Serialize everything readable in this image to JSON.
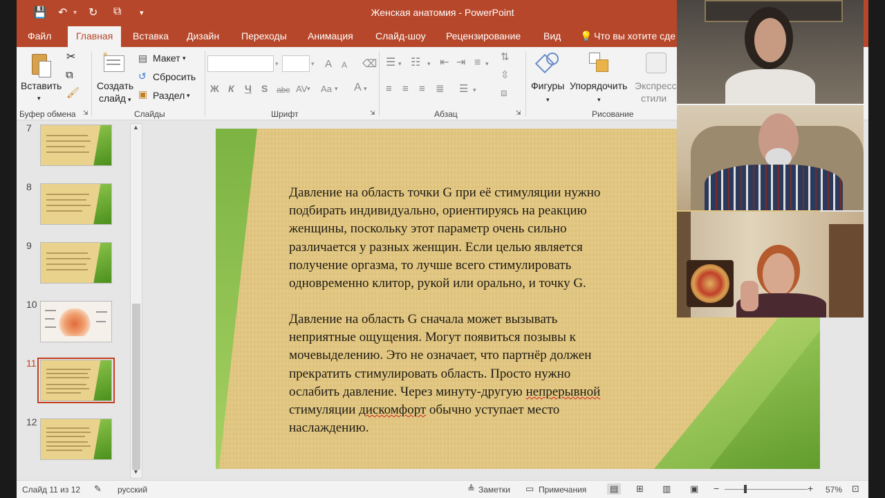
{
  "window": {
    "title": "Женская анатомия - PowerPoint"
  },
  "menu": {
    "tabs": [
      "Файл",
      "Главная",
      "Вставка",
      "Дизайн",
      "Переходы",
      "Анимация",
      "Слайд-шоу",
      "Рецензирование",
      "Вид"
    ],
    "active": "Главная",
    "tell_me": "Что вы хотите сде"
  },
  "ribbon": {
    "clipboard": {
      "paste": "Вставить",
      "label": "Буфер обмена"
    },
    "slides": {
      "new_slide_1": "Создать",
      "new_slide_2": "слайд",
      "layout": "Макет",
      "reset": "Сбросить",
      "section": "Раздел",
      "label": "Слайды"
    },
    "font": {
      "label": "Шрифт",
      "bold": "Ж",
      "italic": "К",
      "underline": "Ч",
      "shadow": "S",
      "strike": "abc",
      "spacing": "AV",
      "case": "Aa",
      "grow": "A",
      "shrink": "A",
      "color": "A"
    },
    "paragraph": {
      "label": "Абзац"
    },
    "drawing": {
      "shapes": "Фигуры",
      "arrange": "Упорядочить",
      "quick_styles_1": "Экспресс",
      "quick_styles_2": "стили",
      "label": "Рисование"
    }
  },
  "thumbnails": [
    {
      "num": "7"
    },
    {
      "num": "8"
    },
    {
      "num": "9"
    },
    {
      "num": "10"
    },
    {
      "num": "11"
    },
    {
      "num": "12"
    }
  ],
  "current_slide": "11",
  "slide": {
    "p1": [
      "Давление на область точки G при её стимуляции нужно",
      "подбирать индивидуально, ориентируясь на реакцию",
      "женщины, поскольку этот параметр очень сильно",
      "различается у разных женщин. Если целью является",
      "получение оргазма, то лучше всего стимулировать",
      "одновременно клитор, рукой или орально, и точку G."
    ],
    "p2": [
      "Давление на область G сначала может вызывать",
      "неприятные ощущения. Могут появиться позывы к",
      "мочевыделению. Это не означает, что партнёр должен",
      "прекратить стимулировать область. Просто нужно",
      "ослабить давление. Через минуту-другую ",
      "непрерывной",
      "стимуляции ",
      "дискомфорт",
      " обычно уступает место",
      "наслаждению."
    ]
  },
  "status": {
    "slide_info": "Слайд 11 из 12",
    "language": "русский",
    "notes": "Заметки",
    "comments": "Примечания",
    "zoom": "57%"
  },
  "colors": {
    "accent": "#b7472a",
    "selected": "#c43e1c"
  }
}
